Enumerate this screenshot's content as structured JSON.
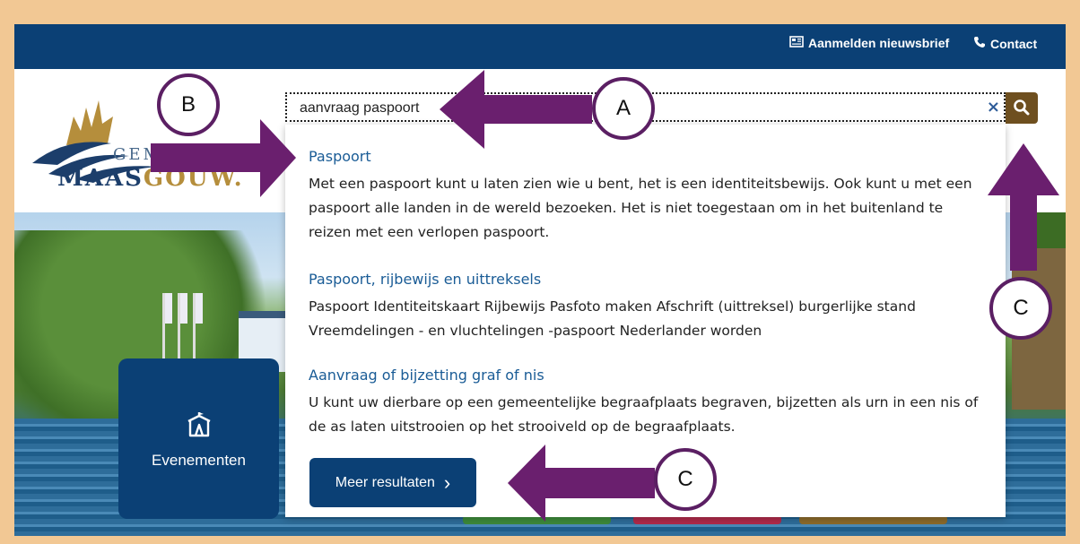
{
  "topbar": {
    "newsletter_label": "Aanmelden nieuwsbrief",
    "contact_label": "Contact"
  },
  "logo": {
    "gem_text": "GEM",
    "maas_text": "MAAS",
    "gouw_text": "GOUW."
  },
  "search": {
    "value": "aanvraag paspoort",
    "clear_symbol": "×"
  },
  "results": [
    {
      "title": "Paspoort",
      "desc": "Met een paspoort kunt u laten zien wie u bent, het is een identiteitsbewijs. Ook kunt u met een paspoort alle landen in de wereld bezoeken. Het is niet toegestaan om in het buitenland te reizen met een verlopen paspoort."
    },
    {
      "title": "Paspoort, rijbewijs en uittreksels",
      "desc": "Paspoort Identiteitskaart Rijbewijs Pasfoto maken Afschrift (uittreksel) burgerlijke stand Vreemdelingen - en vluchtelingen -paspoort Nederlander worden"
    },
    {
      "title": "Aanvraag of bijzetting graf of nis",
      "desc": "U kunt uw dierbare op een gemeentelijke begraafplaats begraven, bijzetten als urn in een nis of de as laten uitstrooien op het strooiveld op de begraafplaats."
    }
  ],
  "more_button_label": "Meer resultaten",
  "more_button_chevron": "›",
  "tile": {
    "label": "Evenementen"
  },
  "annotations": {
    "A": "A",
    "B": "B",
    "C1": "C",
    "C2": "C"
  },
  "colors": {
    "brand_blue": "#0b4075",
    "search_button": "#6e4f1f",
    "arrow_purple": "#6a1f6e",
    "border_peach": "#f2c894"
  }
}
